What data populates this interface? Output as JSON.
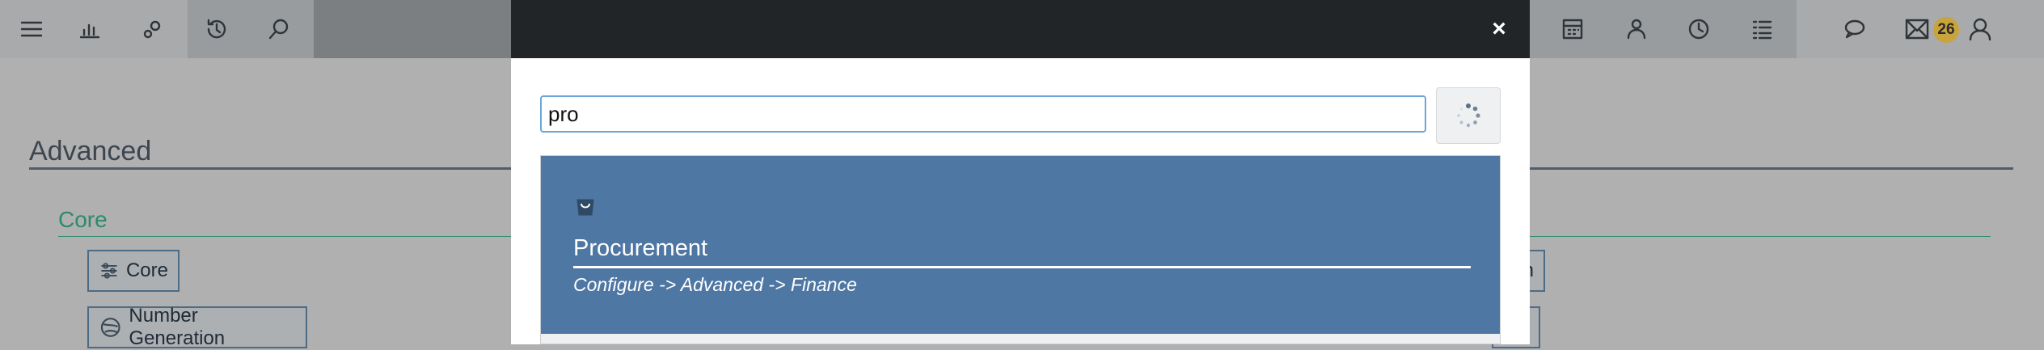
{
  "topbar": {
    "left_icons": [
      "menu-icon",
      "chart-icon",
      "gears-icon",
      "history-icon",
      "search-icon"
    ],
    "right_icons": [
      "calculator-icon",
      "users-icon",
      "clock-icon",
      "list-icon",
      "chat-icon",
      "mail-icon",
      "user-icon"
    ],
    "notification_count": "26"
  },
  "page": {
    "title": "Advanced",
    "section": "Core",
    "chips": {
      "core": "Core",
      "number_generation": "Number Generation",
      "right1": "n",
      "right2": ""
    }
  },
  "modal": {
    "close_label": "×",
    "search": {
      "value": "pro",
      "placeholder": ""
    },
    "results": [
      {
        "title": "Procurement",
        "path": "Configure -> Advanced -> Finance",
        "icon": "shopping-bag-icon"
      }
    ]
  },
  "colors": {
    "result_bg": "#4f77a3",
    "modal_header": "#222527",
    "badge": "#c9a43c",
    "section_green": "#2e8a6a"
  }
}
